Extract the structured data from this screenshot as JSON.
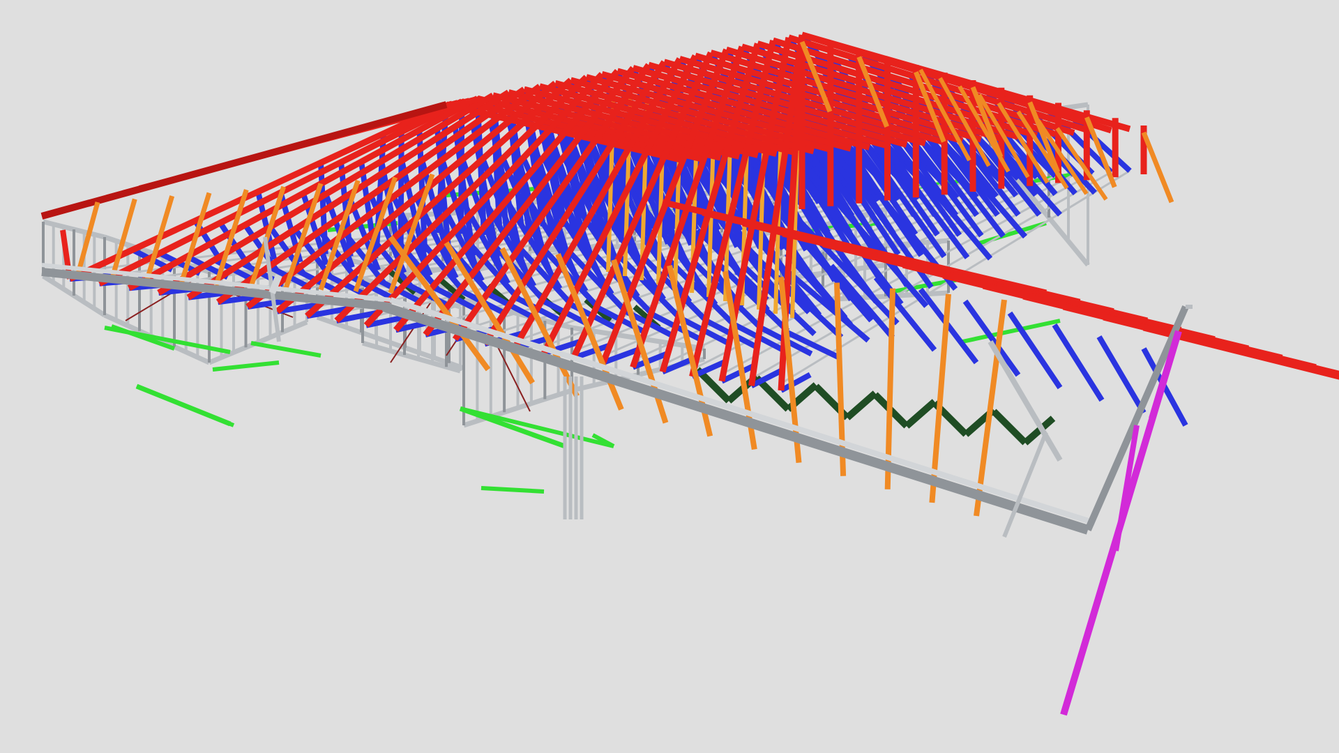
{
  "viewer": {
    "background": "#dfdfdf"
  },
  "colors": {
    "top_chord": "#e8221c",
    "top_chord_dark": "#b81512",
    "web": "#2a34e0",
    "web_dark": "#1a22a8",
    "rafter": "#f08a24",
    "rafter_dark": "#c96a10",
    "post": "#f0a830",
    "wall_frame": "#b9bdc1",
    "wall_frame_dark": "#8f9499",
    "wall_frame_light": "#d2d5d8",
    "nogging": "#33e033",
    "bottom_web": "#1f4d24",
    "column": "#d22ad8",
    "bracing": "#8a2020"
  }
}
